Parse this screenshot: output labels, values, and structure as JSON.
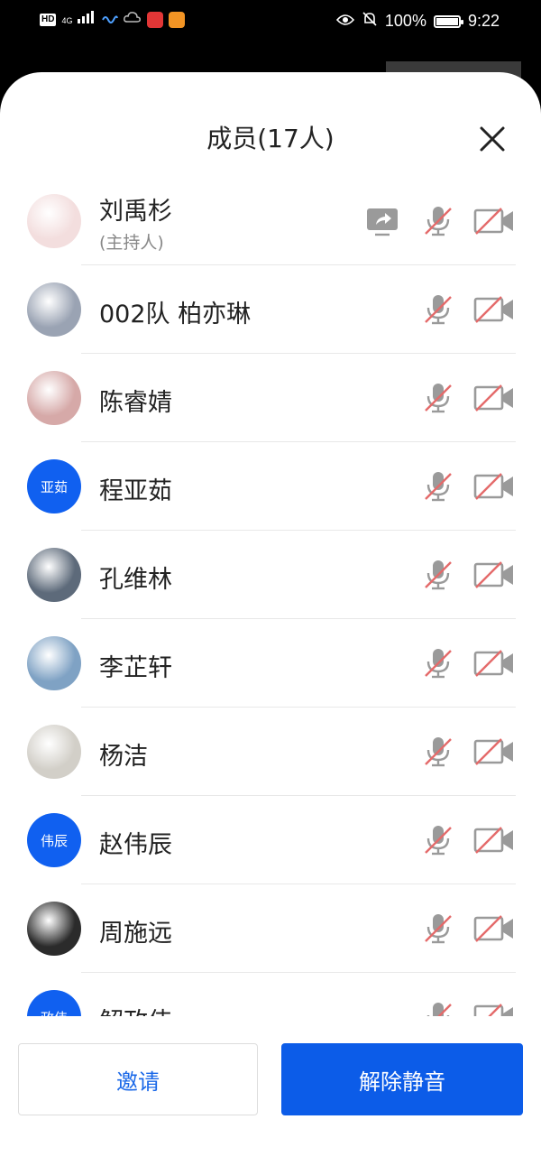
{
  "status_bar": {
    "network": "4G",
    "battery": "100%",
    "time": "9:22"
  },
  "sheet": {
    "title": "成员(17人)",
    "close_icon": "close-icon"
  },
  "members": [
    {
      "name": "刘禹杉",
      "role": "(主持人)",
      "avatar_type": "image",
      "avatar_color": "#f3dede",
      "sharing": true
    },
    {
      "name": "002队 柏亦琳",
      "avatar_type": "image",
      "avatar_color": "#9aa3b3"
    },
    {
      "name": "陈睿婧",
      "avatar_type": "image",
      "avatar_color": "#d6a9a8"
    },
    {
      "name": "程亚茹",
      "avatar_type": "text",
      "avatar_text": "亚茹"
    },
    {
      "name": "孔维林",
      "avatar_type": "image",
      "avatar_color": "#5d6a7a"
    },
    {
      "name": "李芷轩",
      "avatar_type": "image",
      "avatar_color": "#7fa2c4"
    },
    {
      "name": "杨洁",
      "avatar_type": "image",
      "avatar_color": "#d2cfc8"
    },
    {
      "name": "赵伟辰",
      "avatar_type": "text",
      "avatar_text": "伟辰"
    },
    {
      "name": "周施远",
      "avatar_type": "image",
      "avatar_color": "#2b2b2b"
    },
    {
      "name": "解政伟",
      "avatar_type": "text",
      "avatar_text": "政伟"
    }
  ],
  "footer": {
    "invite_label": "邀请",
    "unmute_label": "解除静音"
  },
  "colors": {
    "accent": "#0c5ce8",
    "muted_red": "#e46a6a",
    "icon_gray": "#9a9a9a"
  }
}
